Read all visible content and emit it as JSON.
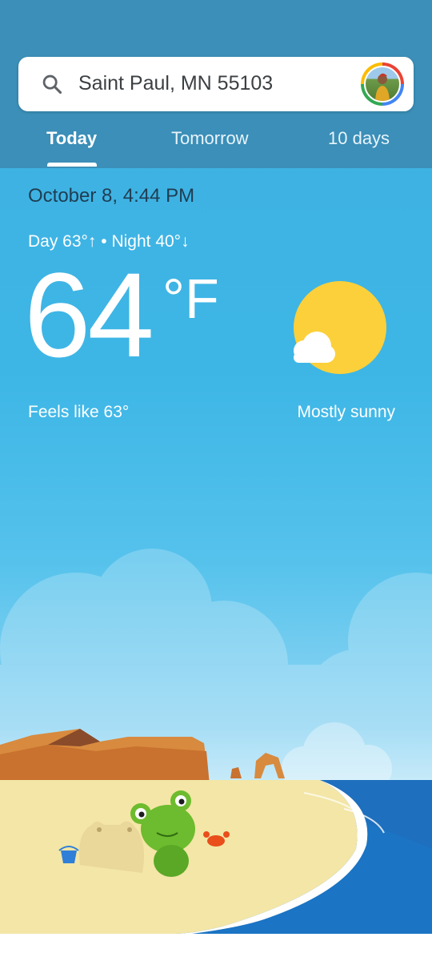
{
  "search": {
    "query": "Saint Paul, MN 55103",
    "icon": "search-icon"
  },
  "tabs": [
    {
      "label": "Today",
      "selected": true
    },
    {
      "label": "Tomorrow",
      "selected": false
    },
    {
      "label": "10 days",
      "selected": false
    }
  ],
  "current": {
    "datetime": "October 8, 4:44 PM",
    "day_night": "Day 63°↑ • Night 40°↓",
    "temperature": "64",
    "unit": "°F",
    "feels_like": "Feels like 63°",
    "condition": "Mostly sunny",
    "condition_icon": "mostly-sunny-icon"
  },
  "colors": {
    "header": "#3b8fb8",
    "sky": "#3db6e6",
    "sun": "#fcd03a"
  }
}
